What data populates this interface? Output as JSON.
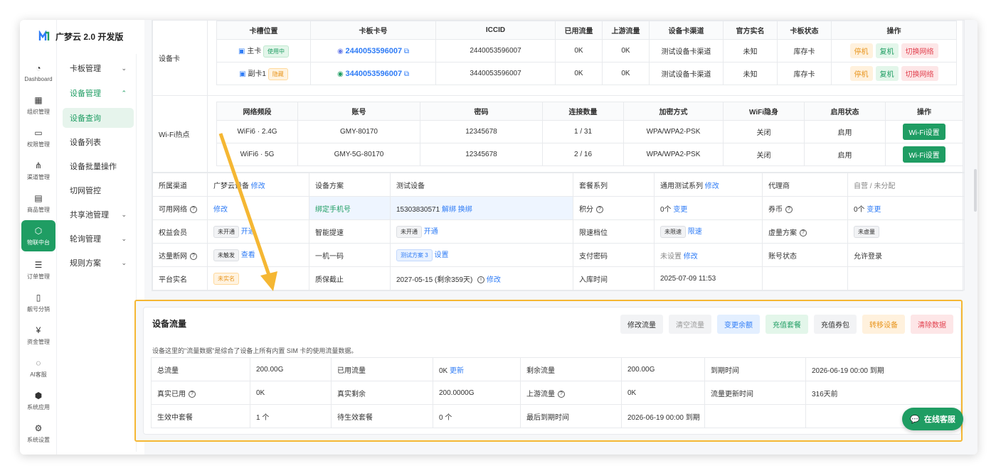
{
  "app": {
    "title": "广梦云 2.0 开发版"
  },
  "rail": [
    {
      "label": "Dashboard",
      "icon": "dashboard-icon",
      "glyph": "◔"
    },
    {
      "label": "组织管理",
      "icon": "org-icon",
      "glyph": "▦"
    },
    {
      "label": "权限管理",
      "icon": "permission-icon",
      "glyph": "▭"
    },
    {
      "label": "渠道管理",
      "icon": "channel-icon",
      "glyph": "⋔"
    },
    {
      "label": "商品管理",
      "icon": "goods-icon",
      "glyph": "▤"
    },
    {
      "label": "物联中台",
      "icon": "iot-icon",
      "glyph": "⬡"
    },
    {
      "label": "订单管理",
      "icon": "order-icon",
      "glyph": "☰"
    },
    {
      "label": "靓号分销",
      "icon": "phone-icon",
      "glyph": "▯"
    },
    {
      "label": "资金管理",
      "icon": "money-icon",
      "glyph": "¥"
    },
    {
      "label": "AI客服",
      "icon": "ai-icon",
      "glyph": "◌"
    },
    {
      "label": "系统应用",
      "icon": "app-icon",
      "glyph": "⬢"
    },
    {
      "label": "系统设置",
      "icon": "settings-icon",
      "glyph": "⚙"
    }
  ],
  "submenu": [
    {
      "label": "卡板管理",
      "chev": "⌄"
    },
    {
      "label": "设备管理",
      "chev": "⌃"
    },
    {
      "label": "设备查询",
      "chev": ""
    },
    {
      "label": "设备列表",
      "chev": ""
    },
    {
      "label": "设备批量操作",
      "chev": ""
    },
    {
      "label": "切网管控",
      "chev": ""
    },
    {
      "label": "共享池管理",
      "chev": "⌄"
    },
    {
      "label": "轮询管理",
      "chev": "⌄"
    },
    {
      "label": "规则方案",
      "chev": "⌄"
    }
  ],
  "device_card": {
    "section_label": "设备卡",
    "headers": [
      "卡槽位置",
      "卡板卡号",
      "ICCID",
      "已用流量",
      "上游流量",
      "设备卡渠道",
      "官方实名",
      "卡板状态",
      "操作"
    ],
    "rows": [
      {
        "slot": "主卡",
        "slot_tag": "使用中",
        "card_no": "2440053596007",
        "iccid": "2440053596007",
        "used": "0K",
        "upstream": "0K",
        "channel": "测试设备卡渠道",
        "realname": "未知",
        "status": "库存卡",
        "actions": [
          "停机",
          "复机",
          "切换网络"
        ]
      },
      {
        "slot": "副卡1",
        "slot_tag": "隐藏",
        "card_no": "3440053596007",
        "iccid": "3440053596007",
        "used": "0K",
        "upstream": "0K",
        "channel": "测试设备卡渠道",
        "realname": "未知",
        "status": "库存卡",
        "actions": [
          "停机",
          "复机",
          "切换网络"
        ]
      }
    ]
  },
  "wifi": {
    "section_label": "Wi-Fi热点",
    "headers": [
      "网络频段",
      "账号",
      "密码",
      "连接数量",
      "加密方式",
      "WiFi隐身",
      "启用状态",
      "操作"
    ],
    "rows": [
      {
        "band": "WiFi6 · 2.4G",
        "ssid": "GMY-80170",
        "password": "12345678",
        "conn": "1 / 31",
        "enc": "WPA/WPA2-PSK",
        "hidden": "关闭",
        "enabled": "启用",
        "action": "Wi-Fi设置"
      },
      {
        "band": "WiFi6 · 5G",
        "ssid": "GMY-5G-80170",
        "password": "12345678",
        "conn": "2 / 16",
        "enc": "WPA/WPA2-PSK",
        "hidden": "关闭",
        "enabled": "启用",
        "action": "Wi-Fi设置"
      }
    ]
  },
  "info": {
    "r1": {
      "l1": "所属渠道",
      "v1": "广梦云设备",
      "a1": "修改",
      "l2": "设备方案",
      "v2": "测试设备",
      "l3": "套餐系列",
      "v3": "通用测试系列",
      "a3": "修改",
      "l4": "代理商",
      "v4": "自营 / 未分配"
    },
    "r2": {
      "l1": "可用网络",
      "a1": "修改",
      "l2": "绑定手机号",
      "v2": "15303830571",
      "a2a": "解绑",
      "a2b": "换绑",
      "l3": "积分",
      "v3": "0个",
      "a3": "变更",
      "l4": "券币",
      "v4": "0个",
      "a4": "变更"
    },
    "r3": {
      "l1": "权益会员",
      "t1": "未开通",
      "a1": "开通",
      "l2": "智能提速",
      "t2": "未开通",
      "a2": "开通",
      "l3": "限速档位",
      "t3": "未限速",
      "a3": "限速",
      "l4": "虚量方案",
      "t4": "未虚量"
    },
    "r4": {
      "l1": "达量断网",
      "t1": "未触发",
      "a1": "查看",
      "l2": "一机一码",
      "t2": "测试方案 3",
      "a2": "设置",
      "l3": "支付密码",
      "v3": "未设置",
      "a3": "修改",
      "l4": "账号状态",
      "v4": "允许登录"
    },
    "r5": {
      "l1": "平台实名",
      "t1": "未实名",
      "l2": "质保截止",
      "v2": "2027-05-15 (剩余359天)",
      "a2": "修改",
      "l3": "入库时间",
      "v3": "2025-07-09 11:53"
    }
  },
  "traffic": {
    "title": "设备流量",
    "buttons": [
      "修改流量",
      "清空流量",
      "变更余额",
      "充值套餐",
      "充值券包",
      "转移设备",
      "清除数据"
    ],
    "note": "设备这里的\"流量数据\"是综合了设备上所有内置 SIM 卡的使用流量数据。",
    "rows": [
      [
        {
          "l": "总流量",
          "v": "200.00G"
        },
        {
          "l": "已用流量",
          "v": "0K",
          "a": "更新"
        },
        {
          "l": "剩余流量",
          "v": "200.00G"
        },
        {
          "l": "到期时间",
          "v": "2026-06-19 00:00 到期"
        }
      ],
      [
        {
          "l": "真实已用",
          "v": "0K",
          "q": true
        },
        {
          "l": "真实剩余",
          "v": "200.0000G"
        },
        {
          "l": "上游流量",
          "v": "0K",
          "q": true
        },
        {
          "l": "流量更新时间",
          "v": "316天前"
        }
      ],
      [
        {
          "l": "生效中套餐",
          "v": "1 个"
        },
        {
          "l": "待生效套餐",
          "v": "0 个"
        },
        {
          "l": "最后到期时间",
          "v": "2026-06-19 00:00 到期"
        },
        {
          "l": "",
          "v": ""
        }
      ]
    ]
  },
  "online_service": "在线客服",
  "colors": {
    "brand_green": "#1f9d63",
    "highlight_border": "#f5b733",
    "link_blue": "#2f7cf6"
  }
}
